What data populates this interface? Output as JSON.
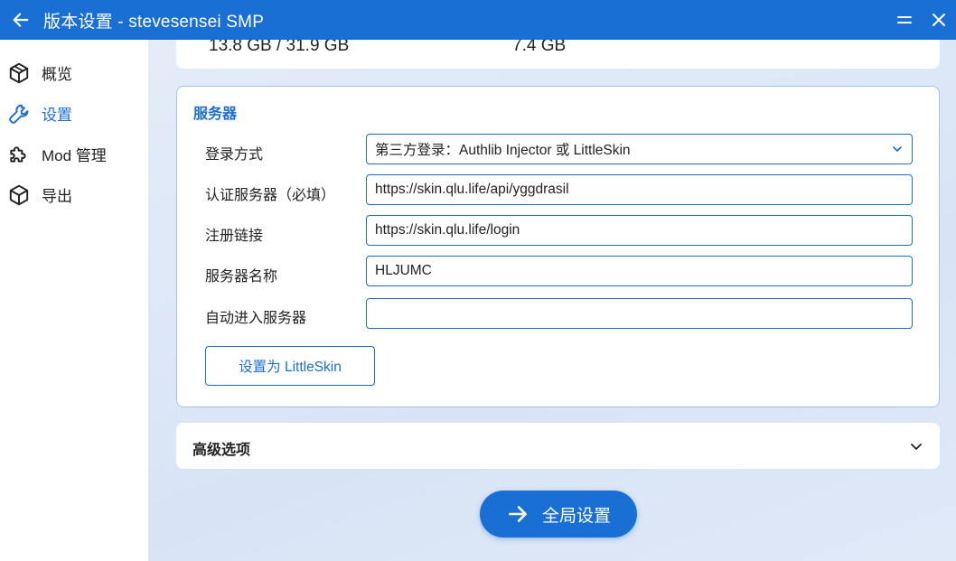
{
  "window": {
    "title": "版本设置 - stevesensei SMP",
    "back_icon": "arrow-left-icon",
    "minimize_icon": "minimize-icon",
    "close_icon": "close-icon"
  },
  "sidebar": {
    "items": [
      {
        "label": "概览",
        "icon": "cube-outline-icon",
        "active": false
      },
      {
        "label": "设置",
        "icon": "wrench-icon",
        "active": true
      },
      {
        "label": "Mod 管理",
        "icon": "puzzle-icon",
        "active": false
      },
      {
        "label": "导出",
        "icon": "package-icon",
        "active": false
      }
    ]
  },
  "storage": {
    "used_total": "13.8 GB / 31.9 GB",
    "available": "7.4 GB"
  },
  "server": {
    "title": "服务器",
    "login_method_label": "登录方式",
    "login_method_value": "第三方登录：Authlib Injector 或 LittleSkin",
    "auth_server_label": "认证服务器（必填）",
    "auth_server_value": "https://skin.qlu.life/api/yggdrasil",
    "register_link_label": "注册链接",
    "register_link_value": "https://skin.qlu.life/login",
    "server_name_label": "服务器名称",
    "server_name_value": "HLJUMC",
    "auto_join_label": "自动进入服务器",
    "auto_join_value": "",
    "littleskin_button": "设置为 LittleSkin"
  },
  "advanced": {
    "title": "高级选项"
  },
  "fab": {
    "label": "全局设置",
    "icon": "arrow-right-icon"
  },
  "colors": {
    "accent": "#1a6fd4",
    "background": "#dbe6f6",
    "card": "#ffffff"
  }
}
